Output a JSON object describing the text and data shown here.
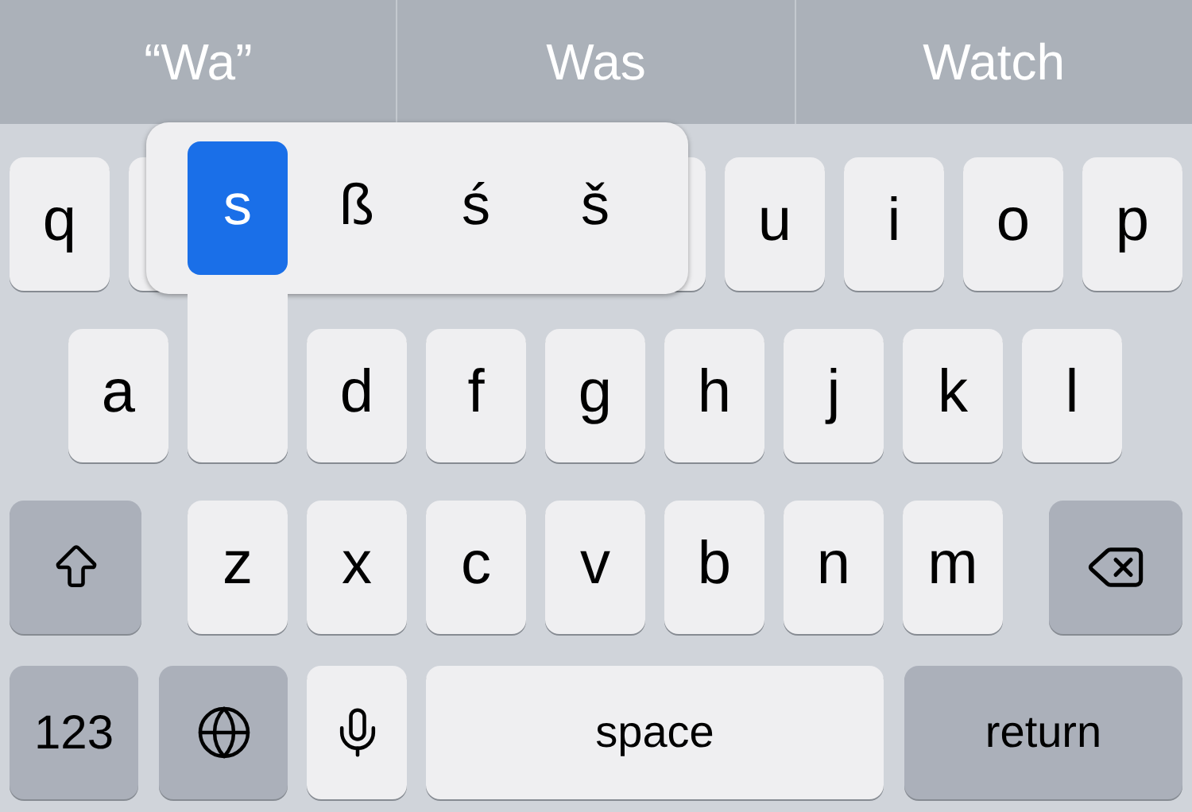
{
  "suggestions": [
    {
      "text": "“Wa”"
    },
    {
      "text": "Was"
    },
    {
      "text": "Watch"
    }
  ],
  "rows": [
    [
      {
        "kind": "letter",
        "label": "q"
      },
      {
        "kind": "covered"
      },
      {
        "kind": "covered"
      },
      {
        "kind": "covered"
      },
      {
        "kind": "covered"
      },
      {
        "kind": "covered"
      },
      {
        "kind": "letter",
        "label": "u"
      },
      {
        "kind": "letter",
        "label": "i"
      },
      {
        "kind": "letter",
        "label": "o"
      },
      {
        "kind": "letter",
        "label": "p"
      }
    ],
    [
      {
        "kind": "letter",
        "label": "a"
      },
      {
        "kind": "covered"
      },
      {
        "kind": "letter",
        "label": "d"
      },
      {
        "kind": "letter",
        "label": "f"
      },
      {
        "kind": "letter",
        "label": "g"
      },
      {
        "kind": "letter",
        "label": "h"
      },
      {
        "kind": "letter",
        "label": "j"
      },
      {
        "kind": "letter",
        "label": "k"
      },
      {
        "kind": "letter",
        "label": "l"
      }
    ],
    [
      {
        "kind": "shift"
      },
      {
        "kind": "letter",
        "label": "z"
      },
      {
        "kind": "letter",
        "label": "x"
      },
      {
        "kind": "letter",
        "label": "c"
      },
      {
        "kind": "letter",
        "label": "v"
      },
      {
        "kind": "letter",
        "label": "b"
      },
      {
        "kind": "letter",
        "label": "n"
      },
      {
        "kind": "letter",
        "label": "m"
      },
      {
        "kind": "backspace"
      }
    ],
    [
      {
        "kind": "mode",
        "label": "123"
      },
      {
        "kind": "globe"
      },
      {
        "kind": "mic"
      },
      {
        "kind": "space",
        "label": "space"
      },
      {
        "kind": "return",
        "label": "return"
      }
    ]
  ],
  "accent_popup": {
    "options": [
      {
        "label": "s",
        "selected": true
      },
      {
        "label": "ß",
        "selected": false
      },
      {
        "label": "ś",
        "selected": false
      },
      {
        "label": "š",
        "selected": false
      }
    ]
  }
}
